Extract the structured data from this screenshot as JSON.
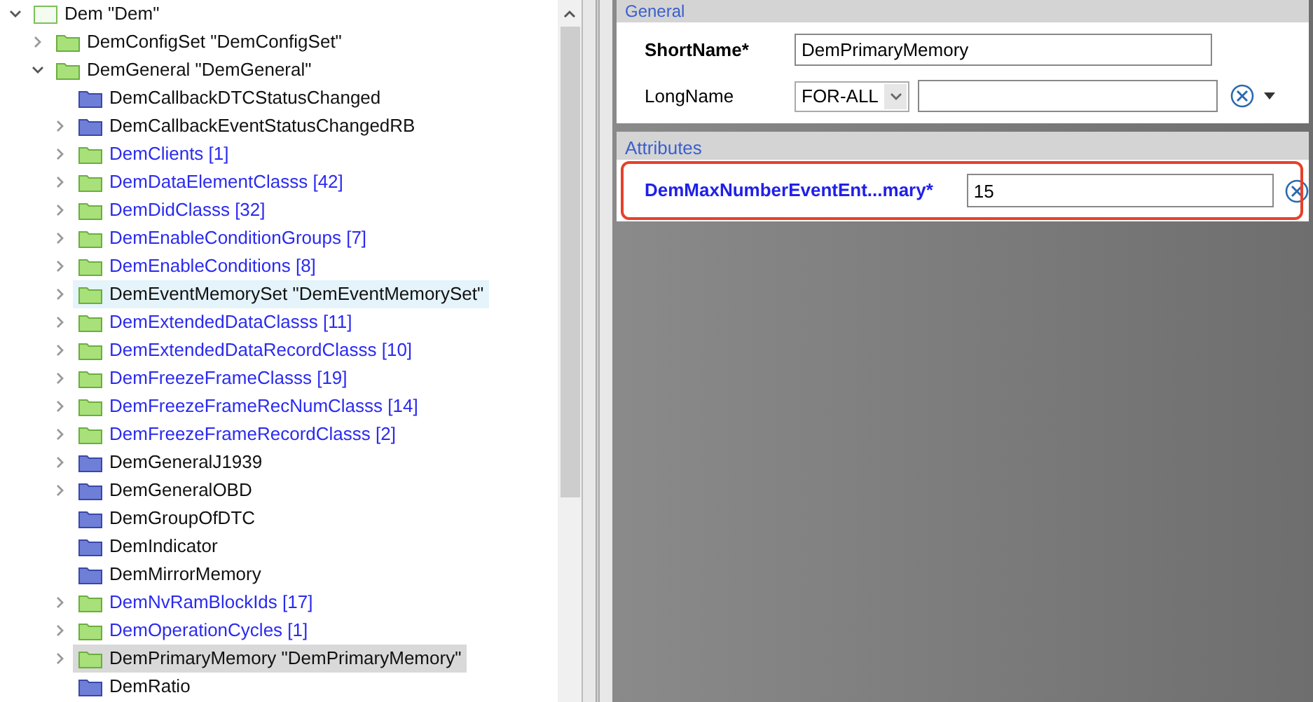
{
  "tree": [
    {
      "label": "Dem \"Dem\"",
      "kind": "root",
      "link": false,
      "expandable": true,
      "expanded": true,
      "selected": false,
      "hovered": false,
      "children": [
        {
          "label": "DemConfigSet \"DemConfigSet\"",
          "kind": "green",
          "link": false,
          "expandable": true,
          "expanded": false,
          "selected": false,
          "hovered": false
        },
        {
          "label": "DemGeneral \"DemGeneral\"",
          "kind": "green",
          "link": false,
          "expandable": true,
          "expanded": true,
          "selected": false,
          "hovered": false,
          "children": [
            {
              "label": "DemCallbackDTCStatusChanged",
              "kind": "blue",
              "link": false,
              "expandable": false,
              "selected": false,
              "hovered": false
            },
            {
              "label": "DemCallbackEventStatusChangedRB",
              "kind": "blue",
              "link": false,
              "expandable": true,
              "expanded": false,
              "selected": false,
              "hovered": false
            },
            {
              "label": "DemClients [1]",
              "kind": "green",
              "link": true,
              "expandable": true,
              "expanded": false,
              "selected": false,
              "hovered": false
            },
            {
              "label": "DemDataElementClasss [42]",
              "kind": "green",
              "link": true,
              "expandable": true,
              "expanded": false,
              "selected": false,
              "hovered": false
            },
            {
              "label": "DemDidClasss [32]",
              "kind": "green",
              "link": true,
              "expandable": true,
              "expanded": false,
              "selected": false,
              "hovered": false
            },
            {
              "label": "DemEnableConditionGroups [7]",
              "kind": "green",
              "link": true,
              "expandable": true,
              "expanded": false,
              "selected": false,
              "hovered": false
            },
            {
              "label": "DemEnableConditions [8]",
              "kind": "green",
              "link": true,
              "expandable": true,
              "expanded": false,
              "selected": false,
              "hovered": false
            },
            {
              "label": "DemEventMemorySet \"DemEventMemorySet\"",
              "kind": "green",
              "link": false,
              "expandable": true,
              "expanded": false,
              "selected": false,
              "hovered": true
            },
            {
              "label": "DemExtendedDataClasss [11]",
              "kind": "green",
              "link": true,
              "expandable": true,
              "expanded": false,
              "selected": false,
              "hovered": false
            },
            {
              "label": "DemExtendedDataRecordClasss [10]",
              "kind": "green",
              "link": true,
              "expandable": true,
              "expanded": false,
              "selected": false,
              "hovered": false
            },
            {
              "label": "DemFreezeFrameClasss [19]",
              "kind": "green",
              "link": true,
              "expandable": true,
              "expanded": false,
              "selected": false,
              "hovered": false
            },
            {
              "label": "DemFreezeFrameRecNumClasss [14]",
              "kind": "green",
              "link": true,
              "expandable": true,
              "expanded": false,
              "selected": false,
              "hovered": false
            },
            {
              "label": "DemFreezeFrameRecordClasss [2]",
              "kind": "green",
              "link": true,
              "expandable": true,
              "expanded": false,
              "selected": false,
              "hovered": false
            },
            {
              "label": "DemGeneralJ1939",
              "kind": "blue",
              "link": false,
              "expandable": true,
              "expanded": false,
              "selected": false,
              "hovered": false
            },
            {
              "label": "DemGeneralOBD",
              "kind": "blue",
              "link": false,
              "expandable": true,
              "expanded": false,
              "selected": false,
              "hovered": false
            },
            {
              "label": "DemGroupOfDTC",
              "kind": "blue",
              "link": false,
              "expandable": false,
              "selected": false,
              "hovered": false
            },
            {
              "label": "DemIndicator",
              "kind": "blue",
              "link": false,
              "expandable": false,
              "selected": false,
              "hovered": false
            },
            {
              "label": "DemMirrorMemory",
              "kind": "blue",
              "link": false,
              "expandable": false,
              "selected": false,
              "hovered": false
            },
            {
              "label": "DemNvRamBlockIds [17]",
              "kind": "green",
              "link": true,
              "expandable": true,
              "expanded": false,
              "selected": false,
              "hovered": false
            },
            {
              "label": "DemOperationCycles [1]",
              "kind": "green",
              "link": true,
              "expandable": true,
              "expanded": false,
              "selected": false,
              "hovered": false
            },
            {
              "label": "DemPrimaryMemory \"DemPrimaryMemory\"",
              "kind": "green",
              "link": false,
              "expandable": true,
              "expanded": false,
              "selected": true,
              "hovered": false
            },
            {
              "label": "DemRatio",
              "kind": "blue",
              "link": false,
              "expandable": false,
              "selected": false,
              "hovered": false
            }
          ]
        }
      ]
    }
  ],
  "general": {
    "title": "General",
    "short_name": {
      "label": "ShortName*",
      "value": "DemPrimaryMemory"
    },
    "long_name": {
      "label": "LongName",
      "language": "FOR-ALL"
    }
  },
  "attributes": {
    "title": "Attributes",
    "fields": [
      {
        "label": "DemMaxNumberEventEnt...mary*",
        "value": "15",
        "highlighted": true
      }
    ]
  }
}
